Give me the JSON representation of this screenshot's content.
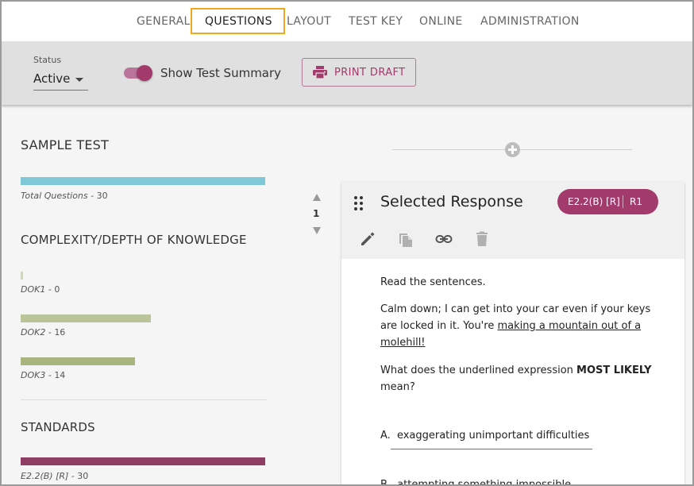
{
  "nav": {
    "tabs": [
      {
        "label": "GENERAL"
      },
      {
        "label": "QUESTIONS",
        "active": true
      },
      {
        "label": "LAYOUT"
      },
      {
        "label": "TEST KEY"
      },
      {
        "label": "ONLINE"
      },
      {
        "label": "ADMINISTRATION"
      }
    ]
  },
  "toolbar": {
    "status_label": "Status",
    "status_value": "Active",
    "toggle_label": "Show Test Summary",
    "toggle_on": true,
    "print_label": "PRINT DRAFT"
  },
  "summary": {
    "title": "SAMPLE TEST",
    "total_caption": "Total Questions",
    "total_count": "30",
    "complexity_title": "COMPLEXITY/DEPTH OF KNOWLEDGE",
    "dok": [
      {
        "label": "DOK1",
        "count": "0",
        "value": 0
      },
      {
        "label": "DOK2",
        "count": "16",
        "value": 16
      },
      {
        "label": "DOK3",
        "count": "14",
        "value": 14
      }
    ],
    "standards_title": "STANDARDS",
    "standards": [
      {
        "label": "E2.2(B) [R]",
        "count": "30",
        "value": 30
      }
    ]
  },
  "colors": {
    "accent": "#a23a6c",
    "total_bar": "#80c8d8",
    "dok_bar": "#b9c49a",
    "dok3_bar": "#a8b57f",
    "standard_bar": "#8e3e63",
    "tab_highlight": "#f0a81c"
  },
  "question": {
    "order": "1",
    "type": "Selected Response",
    "badge_standard": "E2.2(B) [R]",
    "badge_code": "R1",
    "tools": [
      "pencil-icon",
      "copy-icon",
      "link-icon",
      "trash-icon"
    ],
    "instruction": "Read the sentences.",
    "passage_line1": "Calm down; I can get into your car even if your keys",
    "passage_line2_prefix": "are locked in it. You're ",
    "passage_line2_underlined": "making a mountain out of a",
    "passage_line3_underlined": "molehill!",
    "prompt_line1_prefix": "What does the underlined expression ",
    "prompt_bold": "MOST LIKELY",
    "prompt_line2": "mean?",
    "options": [
      {
        "letter": "A.",
        "text": "exaggerating unimportant difficulties"
      },
      {
        "letter": "B.",
        "text": "attempting something impossible"
      }
    ]
  }
}
